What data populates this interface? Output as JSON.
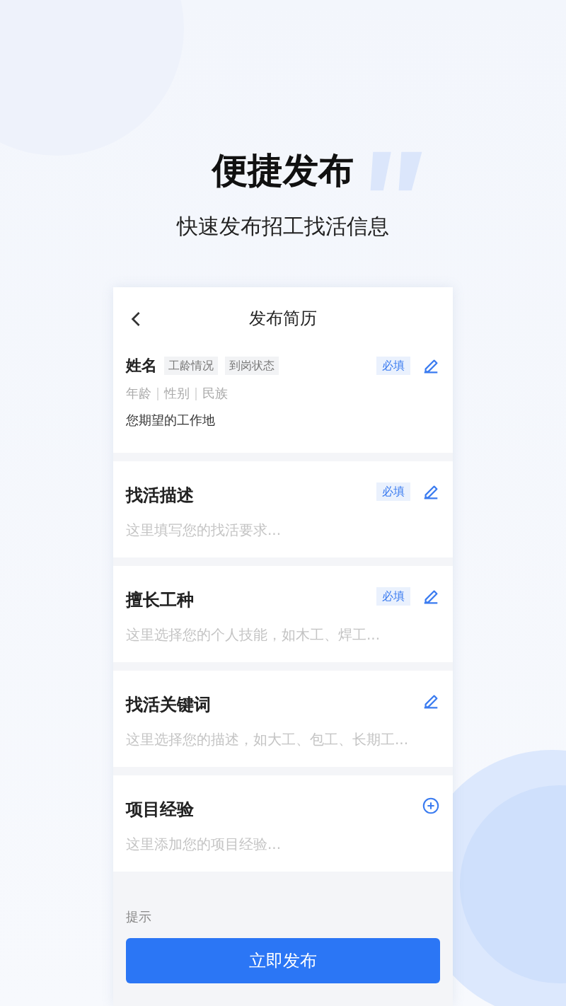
{
  "headline": "便捷发布",
  "subtitle": "快速发布招工找活信息",
  "screen": {
    "title": "发布简历",
    "profile": {
      "name": "姓名",
      "tags": [
        "工龄情况",
        "到岗状态"
      ],
      "details": [
        "年龄",
        "性别",
        "民族"
      ],
      "location": "您期望的工作地",
      "badge": "必填"
    },
    "sections": [
      {
        "kind": "edit",
        "title": "找活描述",
        "badge": "必填",
        "placeholder": "这里填写您的找活要求..."
      },
      {
        "kind": "edit",
        "title": "擅长工种",
        "badge": "必填",
        "placeholder": "这里选择您的个人技能，如木工、焊工..."
      },
      {
        "kind": "edit",
        "title": "找活关键词",
        "placeholder": "这里选择您的描述，如大工、包工、长期工..."
      },
      {
        "kind": "add",
        "title": "项目经验",
        "placeholder": "这里添加您的项目经验..."
      }
    ],
    "tip": "提示",
    "button": "立即发布"
  }
}
